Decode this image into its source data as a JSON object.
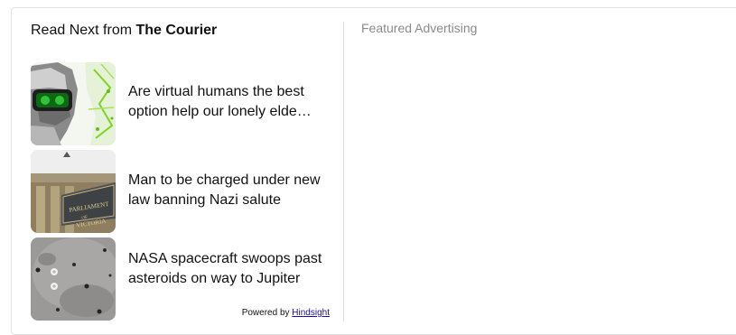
{
  "read_next": {
    "heading_prefix": "Read Next from ",
    "brand": "The Courier",
    "articles": [
      {
        "title": "Are virtual humans the best option help our lonely elde…",
        "image": "vr-headset-elderly-person"
      },
      {
        "title": "Man to be charged under new law banning Nazi salute",
        "image": "parliament-of-victoria-sign"
      },
      {
        "title": "NASA spacecraft swoops past asteroids on way to Jupiter",
        "image": "asteroid-surface"
      }
    ],
    "powered_by_prefix": "Powered by ",
    "powered_by_link": "Hindsight"
  },
  "featured": {
    "label": "Featured Advertising"
  }
}
